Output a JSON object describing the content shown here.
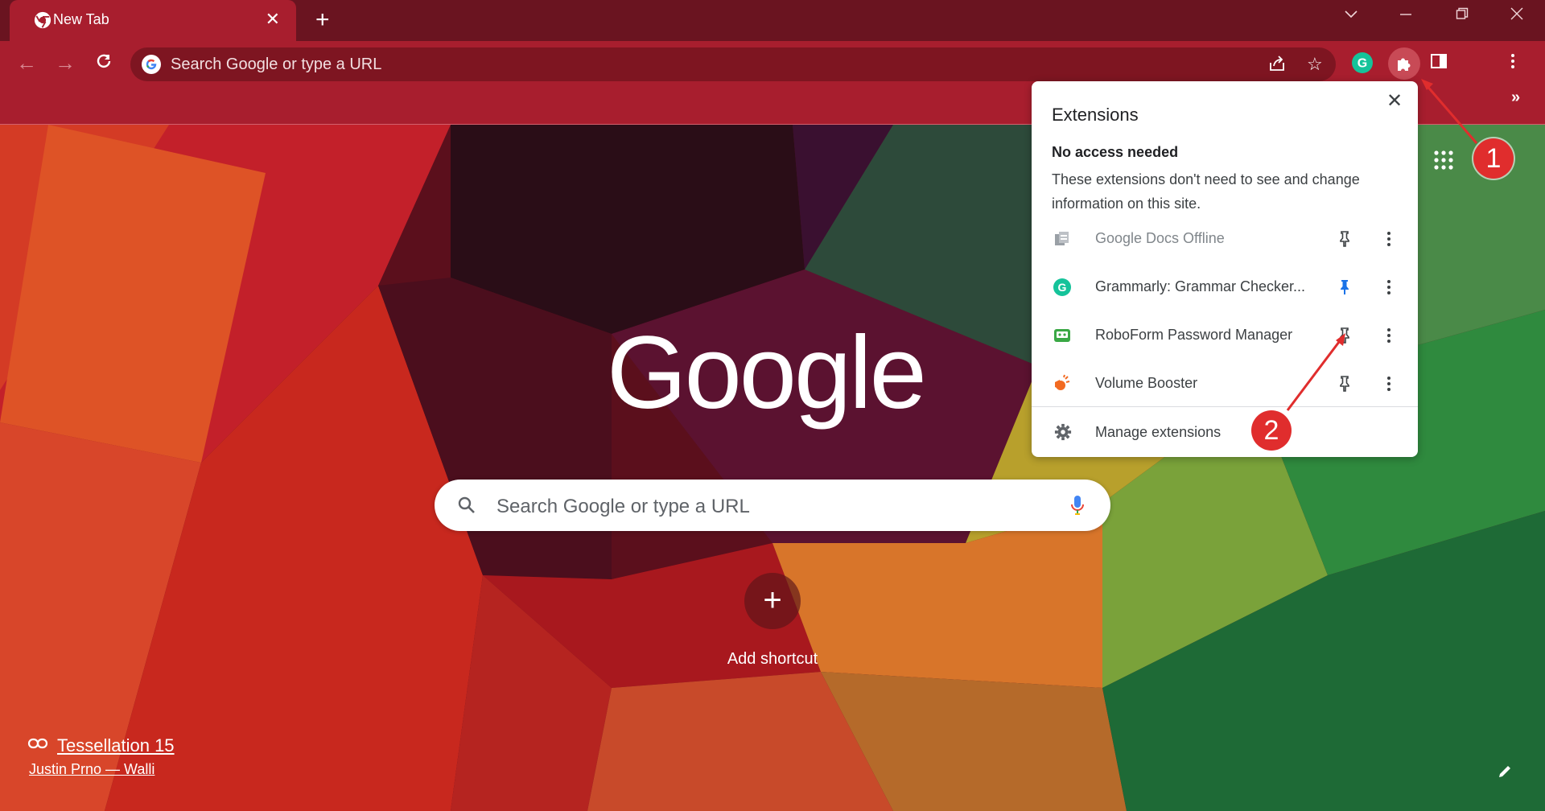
{
  "colors": {
    "tabstrip": "#6a1420",
    "toolbar": "#a81e2e",
    "omnibox": "#7e1521",
    "annotation": "#e02d2d",
    "pinned_blue": "#1a73e8"
  },
  "tab": {
    "title": "New Tab",
    "close_icon": "close-icon"
  },
  "window": {
    "new_tab_icon": "plus-icon",
    "tab_search_icon": "chevron-down-icon",
    "minimize_icon": "minimize-icon",
    "restore_icon": "restore-icon",
    "close_icon": "close-icon"
  },
  "omnibox": {
    "placeholder": "Search Google or type a URL",
    "share_icon": "share-icon",
    "bookmark_icon": "star-icon"
  },
  "toolbar": {
    "back_icon": "arrow-left-icon",
    "forward_icon": "arrow-right-icon",
    "reload_icon": "reload-icon",
    "extensions_icon": "puzzle-icon",
    "side_panel_icon": "side-panel-icon",
    "menu_icon": "kebab-menu-icon",
    "bookmarks_overflow": "»"
  },
  "ntp": {
    "logo": "Google",
    "search_placeholder": "Search Google or type a URL",
    "add_shortcut_symbol": "+",
    "add_shortcut_label": "Add shortcut",
    "background_title": "Tessellation 15",
    "background_author": "Justin Prno — Walli",
    "edit_icon": "pencil-icon",
    "apps_icon": "apps-grid-icon"
  },
  "extensions_popup": {
    "title": "Extensions",
    "section_title": "No access needed",
    "section_description": "These extensions don't need to see and change information on this site.",
    "items": [
      {
        "name": "Google Docs Offline",
        "icon": "docs-offline-icon",
        "pinned": false
      },
      {
        "name": "Grammarly: Grammar Checker...",
        "icon": "grammarly-icon",
        "pinned": true
      },
      {
        "name": "RoboForm Password Manager",
        "icon": "roboform-icon",
        "pinned": false
      },
      {
        "name": "Volume Booster",
        "icon": "volume-booster-icon",
        "pinned": false
      }
    ],
    "manage_label": "Manage extensions"
  },
  "annotations": [
    {
      "label": "1"
    },
    {
      "label": "2"
    }
  ]
}
